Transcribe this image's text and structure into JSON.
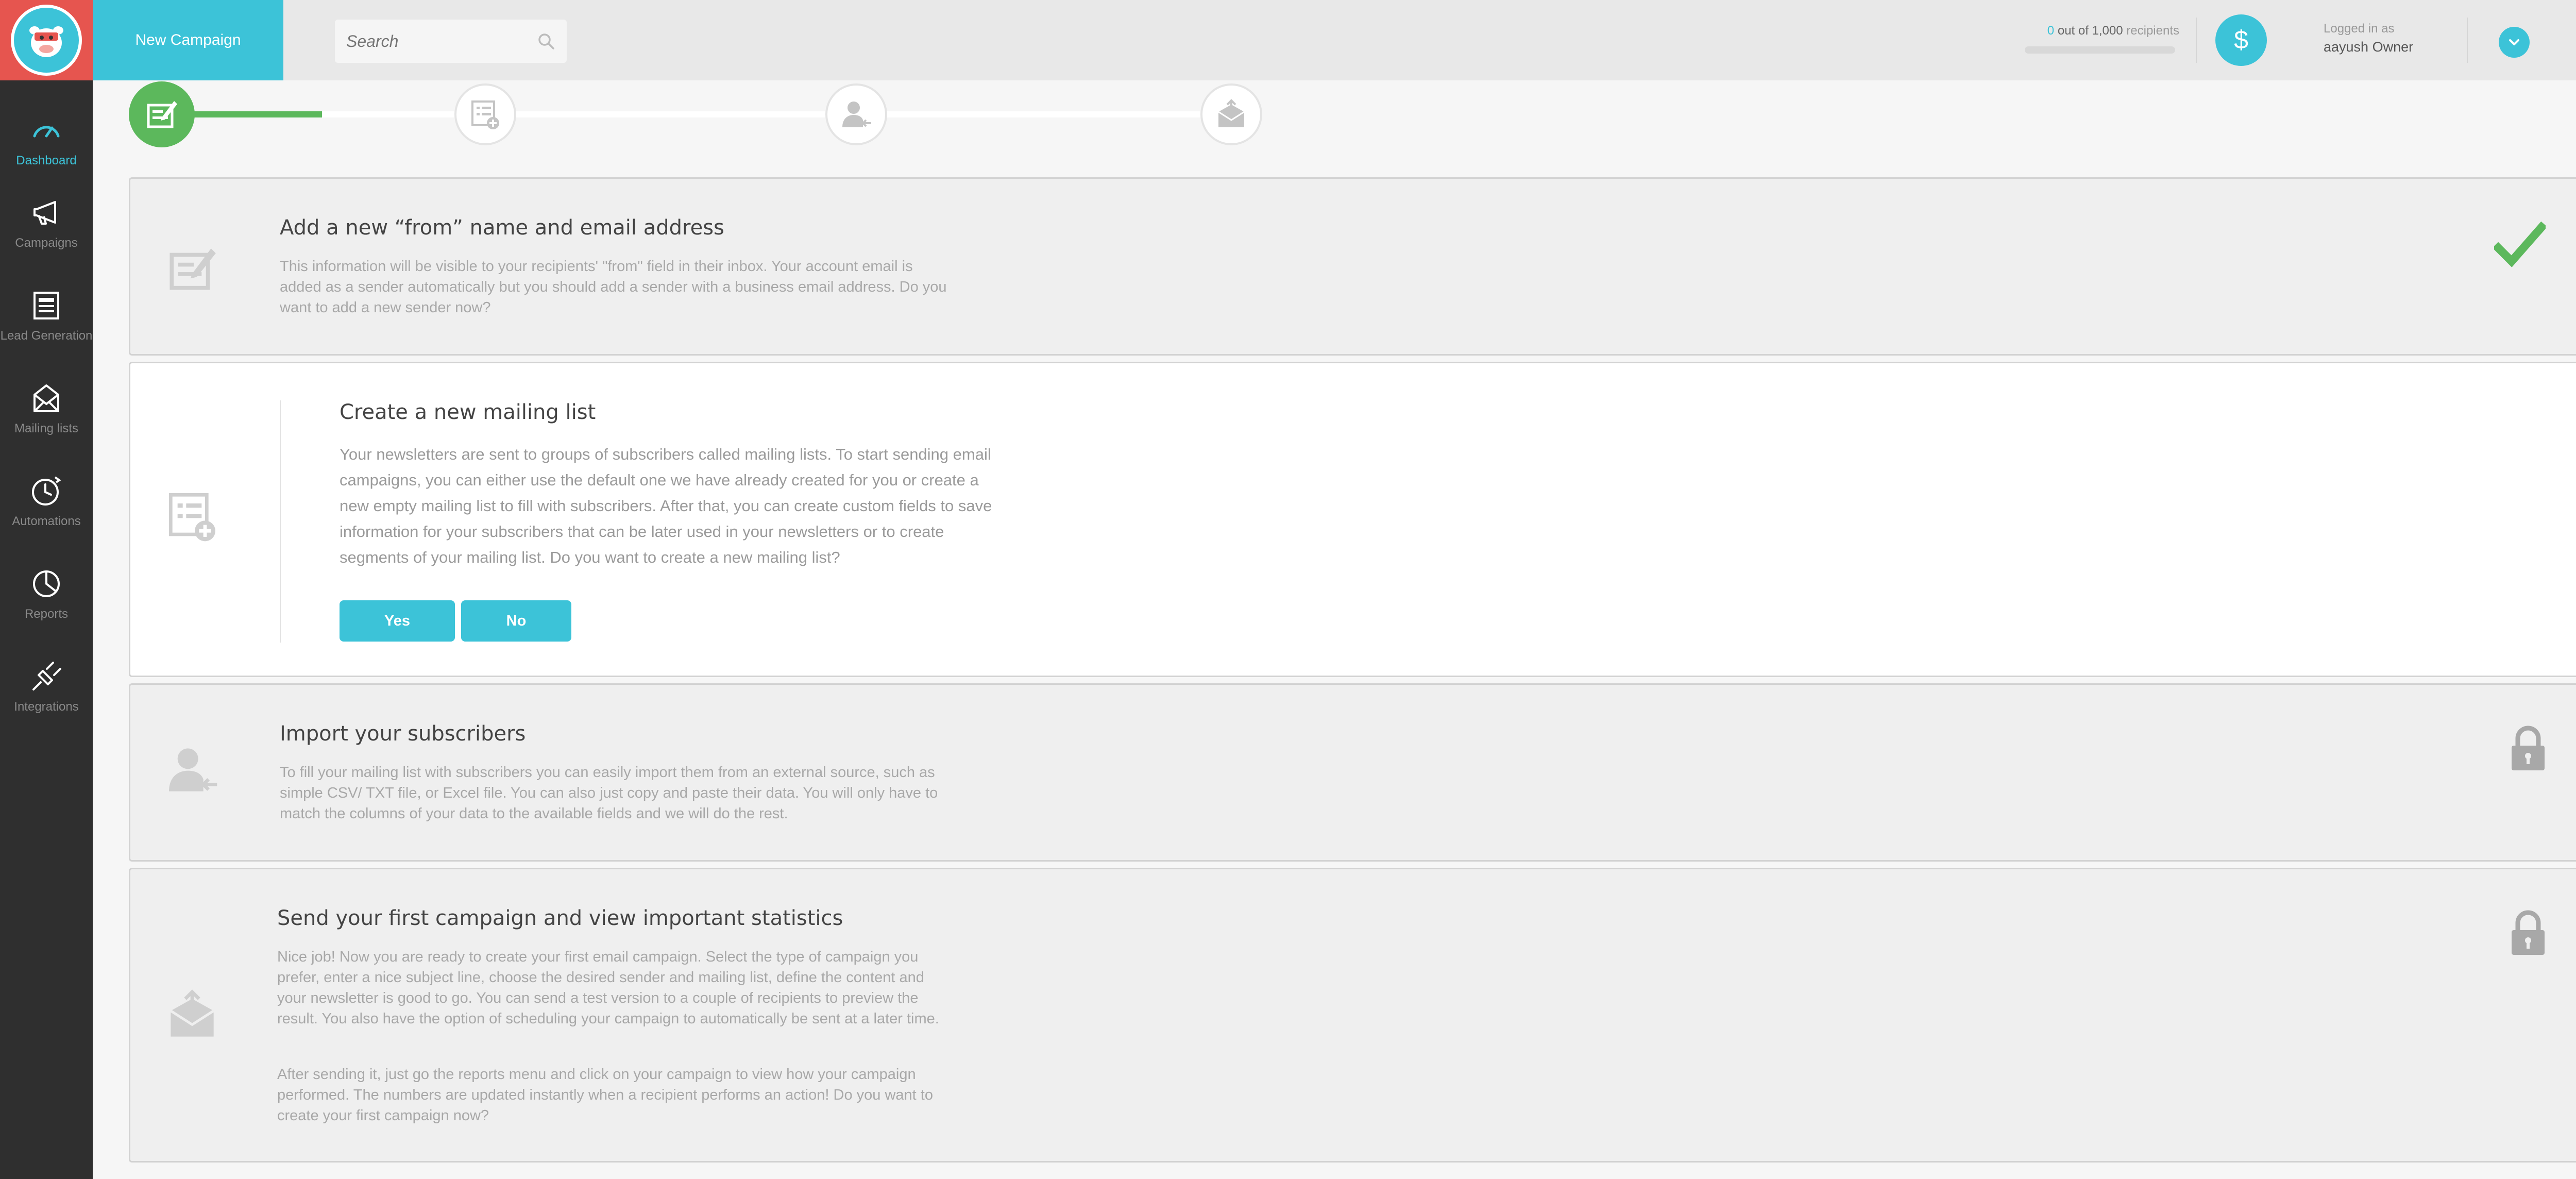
{
  "sidebar": {
    "items": [
      {
        "label": "Dashboard",
        "icon": "dashboard-icon",
        "active": true
      },
      {
        "label": "Campaigns",
        "icon": "megaphone-icon"
      },
      {
        "label": "Lead Generation",
        "icon": "form-icon"
      },
      {
        "label": "Mailing lists",
        "icon": "envelope-icon"
      },
      {
        "label": "Automations",
        "icon": "clock-icon"
      },
      {
        "label": "Reports",
        "icon": "pie-chart-icon"
      },
      {
        "label": "Integrations",
        "icon": "plug-icon"
      }
    ]
  },
  "topbar": {
    "new_campaign": "New Campaign",
    "search_placeholder": "Search",
    "recipients_used": "0",
    "recipients_total": "out of 1,000",
    "recipients_word": "recipients",
    "logged_in_label": "Logged in as",
    "user_name": "aayush Owner"
  },
  "cards": [
    {
      "title": "Add a new “from” name and email address",
      "text": "This information will be visible to your recipients' \"from\" field in their inbox. Your account email is added as a sender automatically but you should add a sender with a business email address. Do you want to add a new sender now?",
      "status": "completed"
    },
    {
      "title": "Create a new mailing list",
      "text": "Your newsletters are sent to groups of subscribers called mailing lists. To start sending email campaigns, you can either use the default one we have already created for you or create a new empty mailing list to fill with subscribers. After that, you can create custom fields to save information for your subscribers that can be later used in your newsletters or to create segments of your mailing list. Do you want to create a new mailing list?",
      "yes": "Yes",
      "no": "No",
      "status": "active"
    },
    {
      "title": "Import your subscribers",
      "text": "To fill your mailing list with subscribers you can easily import them from an external source, such as simple CSV/ TXT file, or Excel file. You can also just copy and paste their data. You will only have to match the columns of your data to the available fields and we will do the rest.",
      "status": "locked"
    },
    {
      "title": "Send your first campaign and view important statistics",
      "text": "Nice job! Now you are ready to create your first email campaign. Select the type of campaign you prefer, enter a nice subject line, choose the desired sender and mailing list, define the content and your newsletter is good to go. You can send a test version to a couple of recipients to preview the result. You also have the option of scheduling your campaign to automatically be sent at a later time.",
      "text2": "After sending it, just go the reports menu and click on your campaign to view how your campaign performed. The numbers are updated instantly when a recipient performs an action! Do you want to create your first campaign now?",
      "status": "locked"
    }
  ],
  "progress": {
    "current_step": 1,
    "total_steps": 4
  },
  "colors": {
    "accent": "#3cc3d8",
    "success": "#5cb85c",
    "logo_bg": "#e6554f",
    "sidebar": "#2f2f2f"
  }
}
